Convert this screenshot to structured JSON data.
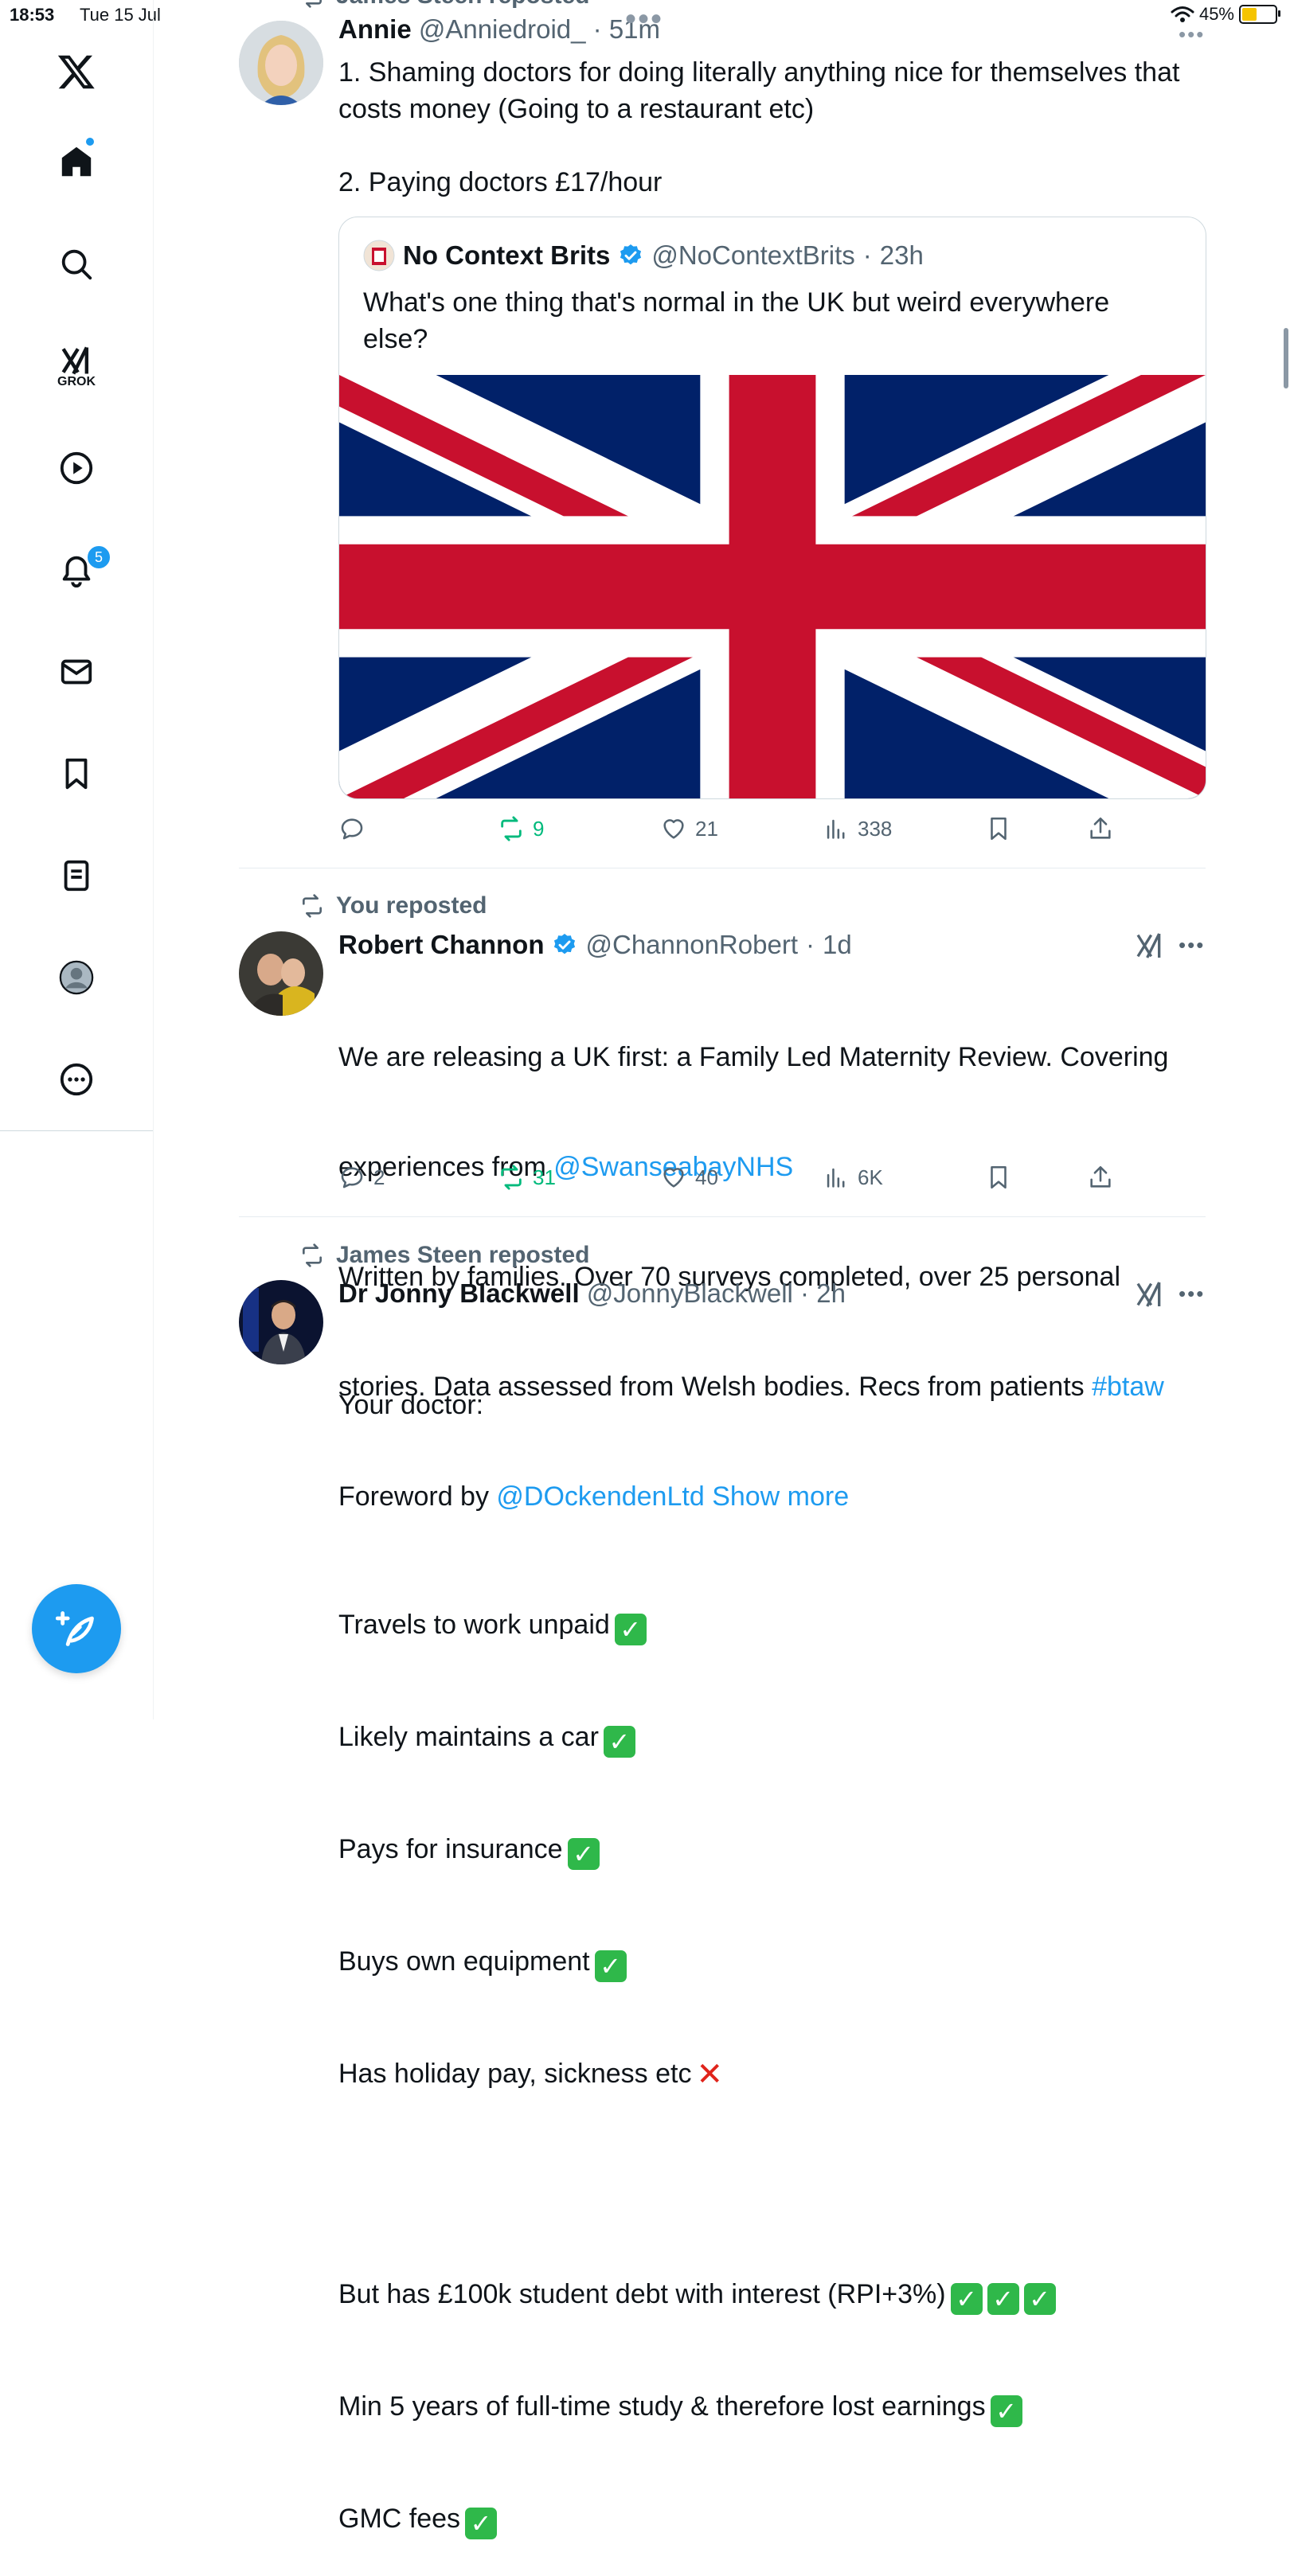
{
  "status": {
    "time": "18:53",
    "date": "Tue 15 Jul",
    "battery": "45%",
    "battery_level": 0.45
  },
  "sidebar": {
    "grok_label": "GROK",
    "notifications_count": "5"
  },
  "tweet1": {
    "repost_label": "James Steen reposted",
    "name": "Annie",
    "handle": "@Anniedroid_",
    "time": "51m",
    "text": "1. Shaming doctors for doing literally anything nice for themselves that costs money (Going to a restaurant etc)\n\n2. Paying doctors £17/hour",
    "quote": {
      "name": "No Context Brits",
      "handle": "@NoContextBrits",
      "time": "23h",
      "text": "What's one thing that's normal in the UK but weird everywhere else?"
    },
    "actions": {
      "replies": "",
      "reposts": "9",
      "likes": "21",
      "views": "338"
    }
  },
  "tweet2": {
    "repost_label": "You reposted",
    "name": "Robert Channon",
    "handle": "@ChannonRobert",
    "time": "1d",
    "line1": "We are releasing a UK first: a Family Led Maternity Review. Covering",
    "line2_prefix": "experiences from ",
    "mention1": "@SwanseabayNHS",
    "line3": "Written by families. Over 70 surveys completed, over 25 personal",
    "line4_prefix": "stories. Data assessed from Welsh bodies. Recs from patients ",
    "hashtag": "#btaw",
    "line5_prefix": "Foreword by ",
    "mention2": "@DOckendenLtd",
    "show_more": "Show more",
    "actions": {
      "replies": "2",
      "reposts": "31",
      "likes": "40",
      "views": "6K"
    }
  },
  "tweet3": {
    "repost_label": "James Steen reposted",
    "name": "Dr Jonny Blackwell",
    "handle": "@JonnyBlackwell",
    "time": "2h",
    "intro": "Your doctor:",
    "items": [
      "Travels to work unpaid",
      "Likely maintains a car",
      "Pays for insurance",
      "Buys own equipment",
      "Has holiday pay, sickness etc",
      "But has £100k student debt with interest (RPI+3%)",
      "Min 5 years of full-time study & therefore lost earnings",
      "GMC fees"
    ]
  }
}
